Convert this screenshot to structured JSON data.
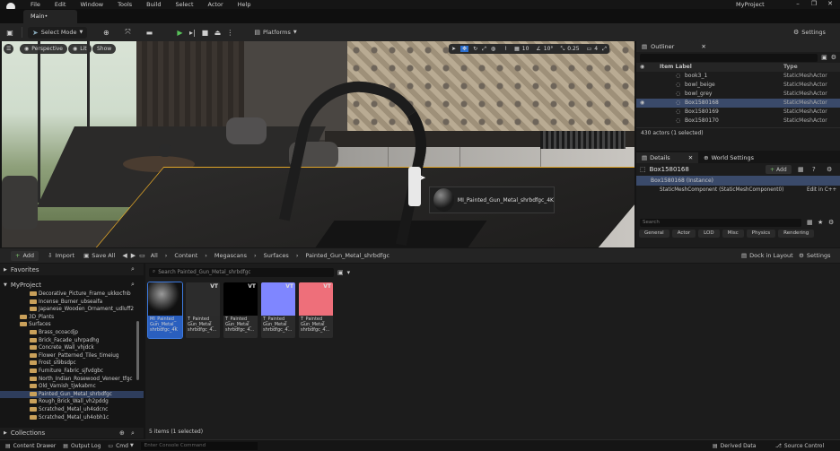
{
  "menu": {
    "items": [
      "File",
      "Edit",
      "Window",
      "Tools",
      "Build",
      "Select",
      "Actor",
      "Help"
    ],
    "project_name": "MyProject"
  },
  "tab": {
    "label": "Main•"
  },
  "toolbar": {
    "select_mode": "Select Mode",
    "platforms": "Platforms",
    "settings": "Settings"
  },
  "viewport": {
    "perspective": "Perspective",
    "lit": "Lit",
    "show": "Show",
    "grid_snap": "10",
    "rot_snap": "10°",
    "scale_snap": "0.25",
    "camera_speed": "4",
    "tooltip": "MI_Painted_Gun_Metal_shrbdfgc_4K"
  },
  "outliner": {
    "title": "Outliner",
    "col_label": "Item Label",
    "col_type": "Type",
    "rows": [
      {
        "label": "book3_1",
        "type": "StaticMeshActor"
      },
      {
        "label": "bowl_beige",
        "type": "StaticMeshActor"
      },
      {
        "label": "bowl_grey",
        "type": "StaticMeshActor"
      },
      {
        "label": "Box1580168",
        "type": "StaticMeshActor"
      },
      {
        "label": "Box1580169",
        "type": "StaticMeshActor"
      },
      {
        "label": "Box1580170",
        "type": "StaticMeshActor"
      }
    ],
    "status": "430 actors (1 selected)"
  },
  "details": {
    "tab_details": "Details",
    "tab_world": "World Settings",
    "actor_name": "Box1580168",
    "add_label": "Add",
    "instance": "Box1580168 (Instance)",
    "component": "StaticMeshComponent (StaticMeshComponent0)",
    "edit_cpp": "Edit in C++",
    "search_placeholder": "Search",
    "filters": [
      "General",
      "Actor",
      "LOD",
      "Misc",
      "Physics",
      "Rendering"
    ]
  },
  "content_browser": {
    "add": "Add",
    "import": "Import",
    "save_all": "Save All",
    "breadcrumb": [
      "All",
      "Content",
      "Megascans",
      "Surfaces",
      "Painted_Gun_Metal_shrbdfgc"
    ],
    "dock": "Dock in Layout",
    "settings": "Settings",
    "search_placeholder": "Search Painted_Gun_Metal_shrbdfgc",
    "favorites": "Favorites",
    "project": "MyProject",
    "tree": [
      {
        "label": "Decorative_Picture_Frame_ukkocfnb",
        "indent": 3,
        "sel": false
      },
      {
        "label": "Incense_Burner_ubseaifa",
        "indent": 3,
        "sel": false
      },
      {
        "label": "Japanese_Wooden_Ornament_udluff2",
        "indent": 3,
        "sel": false
      },
      {
        "label": "3D_Plants",
        "indent": 2,
        "sel": false
      },
      {
        "label": "Surfaces",
        "indent": 2,
        "sel": false
      },
      {
        "label": "Brass_ocoacdjp",
        "indent": 3,
        "sel": false
      },
      {
        "label": "Brick_Facade_uhrpadhg",
        "indent": 3,
        "sel": false
      },
      {
        "label": "Concrete_Wall_vhjdck",
        "indent": 3,
        "sel": false
      },
      {
        "label": "Flower_Patterned_Tiles_timeiug",
        "indent": 3,
        "sel": false
      },
      {
        "label": "Frost_sl9bsdpc",
        "indent": 3,
        "sel": false
      },
      {
        "label": "Furniture_Fabric_sjfvdgbc",
        "indent": 3,
        "sel": false
      },
      {
        "label": "North_Indian_Rosewood_Veneer_tfgc",
        "indent": 3,
        "sel": false
      },
      {
        "label": "Old_Varnish_tjwkabmc",
        "indent": 3,
        "sel": false
      },
      {
        "label": "Painted_Gun_Metal_shrbdfgc",
        "indent": 3,
        "sel": true
      },
      {
        "label": "Rough_Brick_Wall_vh2pddg",
        "indent": 3,
        "sel": false
      },
      {
        "label": "Scratched_Metal_uh4sdcnc",
        "indent": 3,
        "sel": false
      },
      {
        "label": "Scratched_Metal_uh4obh1c",
        "indent": 3,
        "sel": false
      },
      {
        "label": "Scratched_Metal_vdekejzc",
        "indent": 3,
        "sel": false
      }
    ],
    "collections": "Collections",
    "assets": [
      {
        "label": "MI_Painted_\nGun_Metal_\nshrbdfgc_4K",
        "color": "#111111",
        "vt": "",
        "selected": true
      },
      {
        "label": "T_Painted_\nGun_Metal_\nshrbdfgc_4...",
        "color": "#2c2c2c",
        "vt": "VT",
        "selected": false
      },
      {
        "label": "T_Painted_\nGun_Metal_\nshrbdfgc_4...",
        "color": "#000000",
        "vt": "VT",
        "selected": false
      },
      {
        "label": "T_Painted_\nGun_Metal_\nshrbdfgc_4...",
        "color": "#7f86ff",
        "vt": "VT",
        "selected": false
      },
      {
        "label": "T_Painted_\nGun_Metal_\nshrbdfgc_4...",
        "color": "#ee6f7a",
        "vt": "VT",
        "selected": false
      }
    ],
    "status": "5 items (1 selected)"
  },
  "statusbar": {
    "content_drawer": "Content Drawer",
    "output_log": "Output Log",
    "cmd": "Cmd",
    "console_placeholder": "Enter Console Command",
    "derived_data": "Derived Data",
    "source_control": "Source Control"
  }
}
